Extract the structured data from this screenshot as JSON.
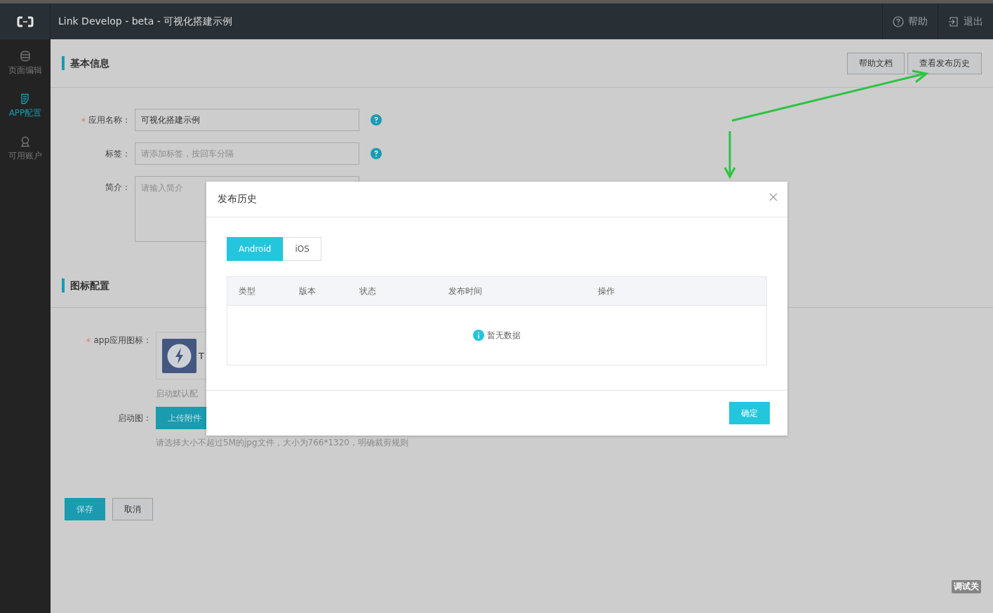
{
  "topbar": {
    "title": "Link Develop - beta - 可视化搭建示例",
    "actions": [
      {
        "label": "帮助",
        "kind": "help"
      },
      {
        "label": "退出",
        "kind": "logout"
      }
    ]
  },
  "sidebar": {
    "items": [
      {
        "label": "页面编辑",
        "kind": "layers",
        "selected": false
      },
      {
        "label": "APP配置",
        "kind": "document",
        "selected": true
      },
      {
        "label": "可用账户",
        "kind": "person",
        "selected": false
      }
    ]
  },
  "header_buttons": [
    "帮助文档",
    "查看发布历史"
  ],
  "basic_info": {
    "title": "基本信息",
    "fields": [
      {
        "label": "应用名称：",
        "required": true,
        "kind": "input",
        "value": "可视化搭建示例",
        "help": true
      },
      {
        "label": "标签：",
        "required": false,
        "kind": "input",
        "placeholder": "请添加标签，按回车分隔",
        "help": true
      },
      {
        "label": "简介：",
        "required": false,
        "kind": "textarea",
        "placeholder": "请输入简介",
        "help": false
      }
    ]
  },
  "icon_config": {
    "title": "图标配置",
    "app_icon": {
      "label": "app应用图标：",
      "required": true,
      "caption": "T",
      "note": "启动默认配"
    },
    "splash": {
      "label": "启动图：",
      "button": "上传附件",
      "hint": "请选择大小不超过5M的jpg文件，大小为766*1320，明确裁剪规则"
    }
  },
  "form_buttons": [
    {
      "label": "保存",
      "kind": "primary"
    },
    {
      "label": "取消",
      "kind": "default"
    }
  ],
  "debug_label": "调试关",
  "modal": {
    "title": "发布历史",
    "tabs": [
      {
        "label": "Android",
        "selected": true
      },
      {
        "label": "iOS",
        "selected": false
      }
    ],
    "table": {
      "columns": [
        "类型",
        "版本",
        "状态",
        "发布时间",
        "操作"
      ],
      "empty_text": "暂无数据"
    },
    "confirm": "确定"
  }
}
